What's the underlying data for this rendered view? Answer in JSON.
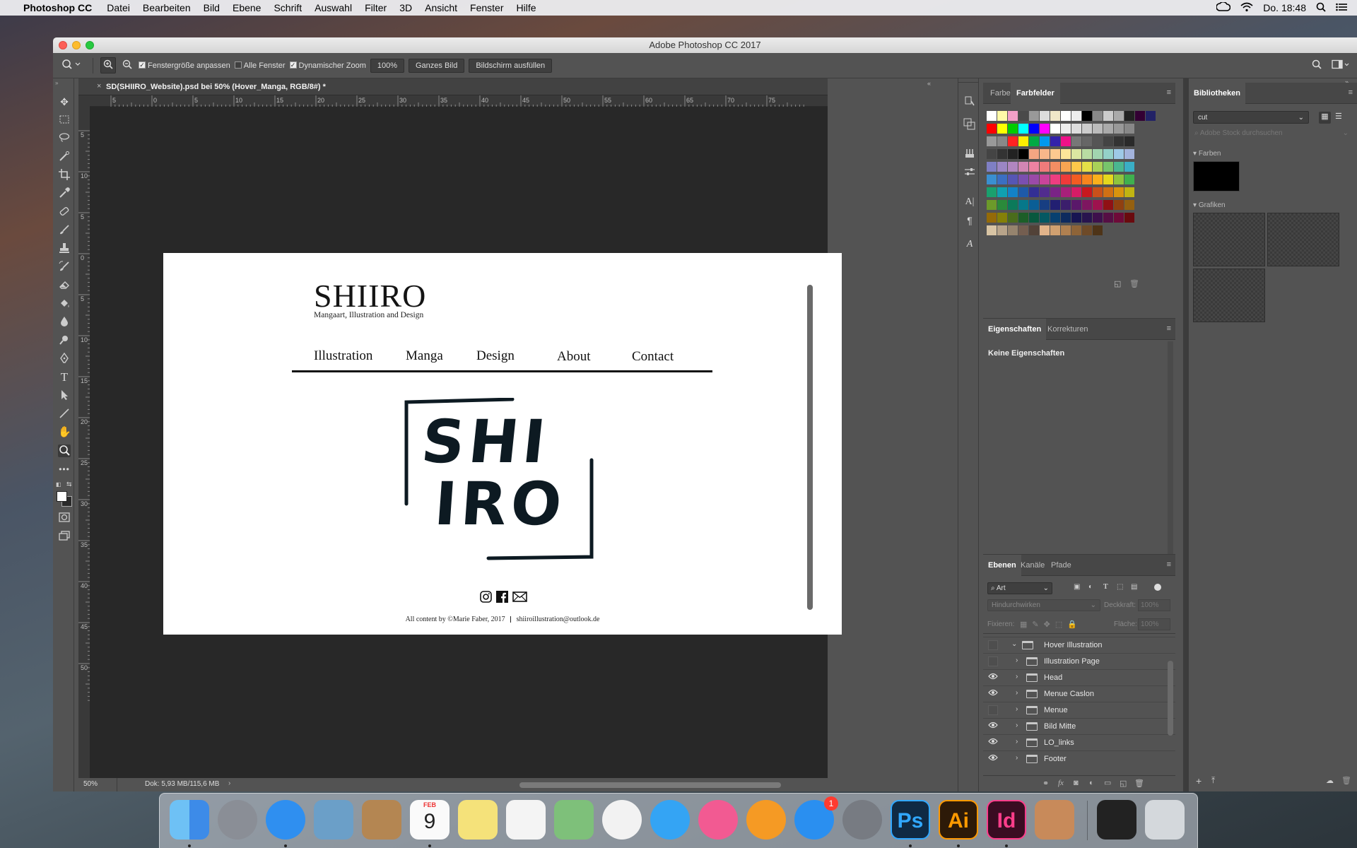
{
  "menubar": {
    "app_name": "Photoshop CC",
    "items": [
      "Datei",
      "Bearbeiten",
      "Bild",
      "Ebene",
      "Schrift",
      "Auswahl",
      "Filter",
      "3D",
      "Ansicht",
      "Fenster",
      "Hilfe"
    ],
    "clock": "Do. 18:48"
  },
  "window": {
    "title": "Adobe Photoshop CC 2017"
  },
  "options_bar": {
    "resize_windows_label": "Fenstergröße anpassen",
    "all_windows_label": "Alle Fenster",
    "scrubby_zoom_label": "Dynamischer Zoom",
    "zoom_value": "100%",
    "fit_screen_label": "Ganzes Bild",
    "fill_screen_label": "Bildschirm ausfüllen"
  },
  "document": {
    "tab_title": "SD(SHIIRO_Website).psd bei 50% (Hover_Manga, RGB/8#) *",
    "ruler_h_labels": [
      "5",
      "0",
      "5",
      "10",
      "15",
      "20",
      "25",
      "30",
      "35",
      "40",
      "45",
      "50",
      "55",
      "60",
      "65",
      "70",
      "75"
    ],
    "ruler_v_labels": [
      "5",
      "1 0",
      "5",
      "0",
      "5",
      "1 0",
      "1 5",
      "2 0",
      "2 5",
      "3 0",
      "3 5",
      "4 0",
      "4 5",
      "5 0"
    ],
    "status_zoom": "50%",
    "status_doc": "Dok: 5,93 MB/115,6 MB"
  },
  "artboard": {
    "brand": "SHIIRO",
    "tagline": "Mangaart, Illustration and Design",
    "nav": [
      "Illustration",
      "Manga",
      "Design",
      "About",
      "Contact"
    ],
    "logo_line1": "SHI",
    "logo_line2": "IRO",
    "footer_text": "All content by ©Marie Faber, 2017",
    "footer_email": "shiiroillustration@outlook.de"
  },
  "swatches_panel": {
    "tab_color": "Farbe",
    "tab_swatches": "Farbfelder",
    "colors": [
      "#ffffff",
      "#fff9a8",
      "#f3a0c8",
      "#4a4a4a",
      "#999999",
      "#dddddd",
      "#f0e8c8",
      "#ffffff",
      "#eeeeee",
      "#000000",
      "#888888",
      "#cccccc",
      "#aaaaaa",
      "#222222",
      "#330033",
      "#222266",
      "#ff0000",
      "#ffff00",
      "#00cc00",
      "#00ffff",
      "#0000ff",
      "#ff00ff",
      "#ffffff",
      "#eeeeee",
      "#dddddd",
      "#cccccc",
      "#bbbbbb",
      "#aaaaaa",
      "#999999",
      "#888888",
      "#999999",
      "#888888",
      "#ff2222",
      "#ffee00",
      "#00aa44",
      "#0099ee",
      "#3322aa",
      "#ee1188",
      "#777777",
      "#666666",
      "#555555",
      "#444444",
      "#333333",
      "#2a2a2a",
      "#444444",
      "#333333",
      "#222222",
      "#000000",
      "#f4a582",
      "#f8b68a",
      "#fcc98f",
      "#fde599",
      "#dbe6a1",
      "#b9dca3",
      "#a1d5b0",
      "#94d1c8",
      "#9ec9e6",
      "#a3b3dc",
      "#7f7fc4",
      "#9b86c4",
      "#b186c0",
      "#d186b4",
      "#ee82a2",
      "#f07b7b",
      "#f48e63",
      "#f7a552",
      "#fdc84a",
      "#e5e048",
      "#a9d158",
      "#77c46b",
      "#4ab790",
      "#3aaec5",
      "#3a8fd0",
      "#3b6fc2",
      "#5656b4",
      "#7a4fb0",
      "#9a4aa8",
      "#c8449a",
      "#ee3d80",
      "#ef3a3a",
      "#f25c22",
      "#f7851e",
      "#fbb01b",
      "#e5d81d",
      "#8ec43e",
      "#3fb04e",
      "#1aa06e",
      "#10a0b0",
      "#1382c7",
      "#1e5aa8",
      "#332f94",
      "#512c8e",
      "#7a2386",
      "#a8207a",
      "#d61c66",
      "#c8181e",
      "#c8501a",
      "#d07014",
      "#d8940e",
      "#c0b412",
      "#6c9a2a",
      "#2a8a3a",
      "#0b7a5a",
      "#06788a",
      "#0a5e96",
      "#173e82",
      "#221f72",
      "#3b1e6c",
      "#5a186a",
      "#7e1660",
      "#9e124e",
      "#901014",
      "#904010",
      "#946010",
      "#946a08",
      "#848008",
      "#4a6c1c",
      "#1c5e28",
      "#08583e",
      "#045862",
      "#084070",
      "#0e2a5e",
      "#171552",
      "#28144e",
      "#3e104c",
      "#560e44",
      "#6e0a38",
      "#6a0a0e",
      "#d8c4a4",
      "#b8a48a",
      "#96846e",
      "#745e50",
      "#524238",
      "#e2b48a",
      "#d0a070",
      "#b08050",
      "#8e6438",
      "#6e4a28",
      "#4e3418"
    ]
  },
  "properties_panel": {
    "tab_properties": "Eigenschaften",
    "tab_adjustments": "Korrekturen",
    "empty_label": "Keine Eigenschaften"
  },
  "layers_panel": {
    "tab_layers": "Ebenen",
    "tab_channels": "Kanäle",
    "tab_paths": "Pfade",
    "filter_kind": "Art",
    "blend_mode": "Hindurchwirken",
    "opacity_label": "Deckkraft:",
    "opacity_value": "100%",
    "lock_label": "Fixieren:",
    "fill_label": "Fläche:",
    "fill_value": "100%",
    "layers": [
      {
        "name": "Hover Illustration",
        "visible": false,
        "expanded": true
      },
      {
        "name": "Illustration Page",
        "visible": false,
        "expanded": false
      },
      {
        "name": "Head",
        "visible": true,
        "expanded": false
      },
      {
        "name": "Menue Caslon",
        "visible": true,
        "expanded": false
      },
      {
        "name": "Menue",
        "visible": false,
        "expanded": false
      },
      {
        "name": "Bild Mitte",
        "visible": true,
        "expanded": false
      },
      {
        "name": "LO_links",
        "visible": true,
        "expanded": false
      },
      {
        "name": "Footer",
        "visible": true,
        "expanded": false
      }
    ]
  },
  "libraries_panel": {
    "tab": "Bibliotheken",
    "library_select": "cut",
    "search_placeholder": "Adobe Stock durchsuchen",
    "section_colors": "Farben",
    "section_graphics": "Grafiken",
    "color_swatch": "#000000"
  },
  "dock": {
    "apps": [
      {
        "name": "finder",
        "label": "",
        "color": "#3d8be8",
        "running": true
      },
      {
        "name": "launchpad",
        "label": "",
        "color": "#8a8e96",
        "running": false
      },
      {
        "name": "safari",
        "label": "",
        "color": "#2f8ff0",
        "running": true
      },
      {
        "name": "preview",
        "label": "",
        "color": "#6b9fc8",
        "running": false
      },
      {
        "name": "contacts",
        "label": "",
        "color": "#b48652",
        "running": false
      },
      {
        "name": "calendar",
        "label": "9",
        "month": "FEB",
        "color": "#fafafa",
        "running": true
      },
      {
        "name": "notes",
        "label": "",
        "color": "#f5e27a",
        "running": false
      },
      {
        "name": "reminders",
        "label": "",
        "color": "#f4f4f4",
        "running": false
      },
      {
        "name": "maps",
        "label": "",
        "color": "#7ec07a",
        "running": false
      },
      {
        "name": "photos",
        "label": "",
        "color": "#f2f2f2",
        "running": false
      },
      {
        "name": "messages",
        "label": "",
        "color": "#34a4f4",
        "running": false
      },
      {
        "name": "itunes",
        "label": "",
        "color": "#f25a92",
        "running": false
      },
      {
        "name": "ibooks",
        "label": "",
        "color": "#f59a24",
        "running": false
      },
      {
        "name": "app-store",
        "label": "",
        "color": "#2a8ff0",
        "running": false,
        "badge": "1"
      },
      {
        "name": "system-preferences",
        "label": "",
        "color": "#777b82",
        "running": false
      },
      {
        "name": "photoshop",
        "label": "Ps",
        "color": "#0f2a44",
        "text_color": "#31a8ff",
        "running": true
      },
      {
        "name": "illustrator",
        "label": "Ai",
        "color": "#2d1a08",
        "text_color": "#ff9a00",
        "running": true
      },
      {
        "name": "indesign",
        "label": "Id",
        "color": "#3a0c22",
        "text_color": "#ff3d8b",
        "running": true
      },
      {
        "name": "calculator",
        "label": "",
        "color": "#c88a5a",
        "running": false
      },
      {
        "name": "downloads-stack",
        "label": "",
        "color": "#222",
        "running": false
      },
      {
        "name": "trash",
        "label": "",
        "color": "#d4d8dc",
        "running": false
      }
    ]
  }
}
